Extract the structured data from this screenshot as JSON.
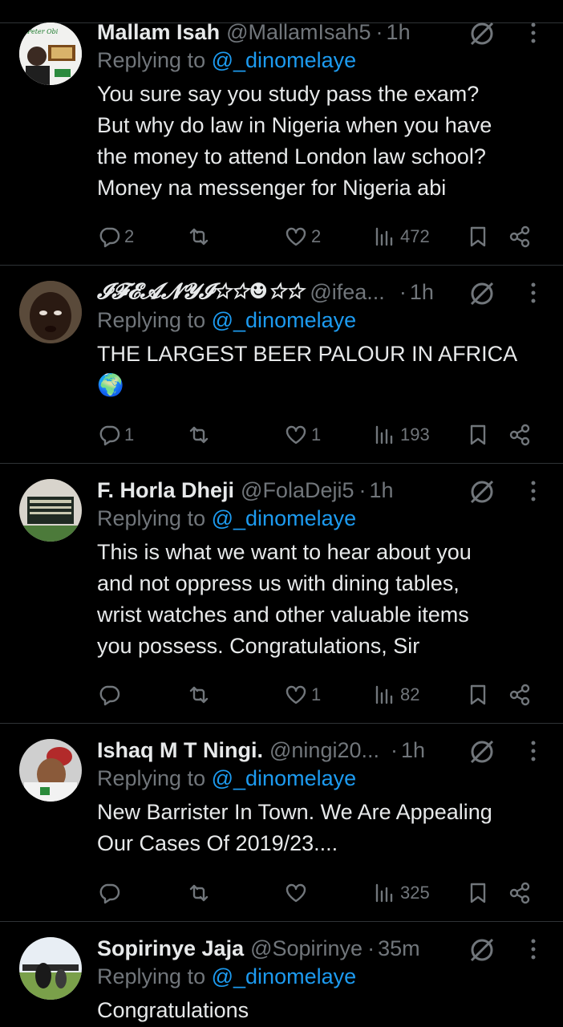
{
  "tweets": [
    {
      "name": "Mallam Isah",
      "handle": "@MallamIsah5",
      "time": "1h",
      "replying_prefix": "Replying to",
      "replying_to": "@_dinomelaye",
      "text": [
        "You sure say you study pass the exam?",
        "But why do law in Nigeria when you have",
        "the money to attend London law school?",
        "Money na messenger for Nigeria abi"
      ],
      "replies": "2",
      "retweets": "",
      "likes": "2",
      "views": "472",
      "avatar_text": "Peter Obi"
    },
    {
      "name": "𝓘𝓕𝓔𝓐𝓝𝓨𝓘☆☆☻☆☆",
      "handle": "@ifea...",
      "time": "1h",
      "replying_prefix": "Replying to",
      "replying_to": "@_dinomelaye",
      "text": [
        "THE LARGEST BEER PALOUR IN AFRICA",
        "🌍"
      ],
      "replies": "1",
      "retweets": "",
      "likes": "1",
      "views": "193"
    },
    {
      "name": "F. Horla Dheji",
      "handle": "@FolaDeji5",
      "time": "1h",
      "replying_prefix": "Replying to",
      "replying_to": "@_dinomelaye",
      "text": [
        "This is what we want to hear about you",
        "and not oppress us with dining tables,",
        "wrist watches and other valuable items",
        "you possess. Congratulations, Sir"
      ],
      "replies": "",
      "retweets": "",
      "likes": "1",
      "views": "82"
    },
    {
      "name": "Ishaq M T Ningi.",
      "handle": "@ningi20...",
      "time": "1h",
      "replying_prefix": "Replying to",
      "replying_to": "@_dinomelaye",
      "text": [
        "New Barrister In Town. We Are Appealing",
        "Our Cases Of 2019/23...."
      ],
      "replies": "",
      "retweets": "",
      "likes": "",
      "views": "325"
    },
    {
      "name": "Sopirinye Jaja",
      "handle": "@Sopirinye",
      "time": "35m",
      "replying_prefix": "Replying to",
      "replying_to": "@_dinomelaye",
      "text": [
        "Congratulations"
      ],
      "replies": "",
      "retweets": "",
      "likes": "",
      "views": ""
    }
  ],
  "icons": {
    "reply": "reply-icon",
    "retweet": "retweet-icon",
    "like": "heart-icon",
    "views": "views-chart-icon",
    "bookmark": "bookmark-icon",
    "share": "share-icon",
    "grok": "grok-icon",
    "more": "more-vertical-icon"
  },
  "colors": {
    "background": "#000000",
    "mention": "#1d9bf0",
    "muted": "#71767b",
    "text": "#e7e9ea",
    "divider": "#2f3336"
  }
}
